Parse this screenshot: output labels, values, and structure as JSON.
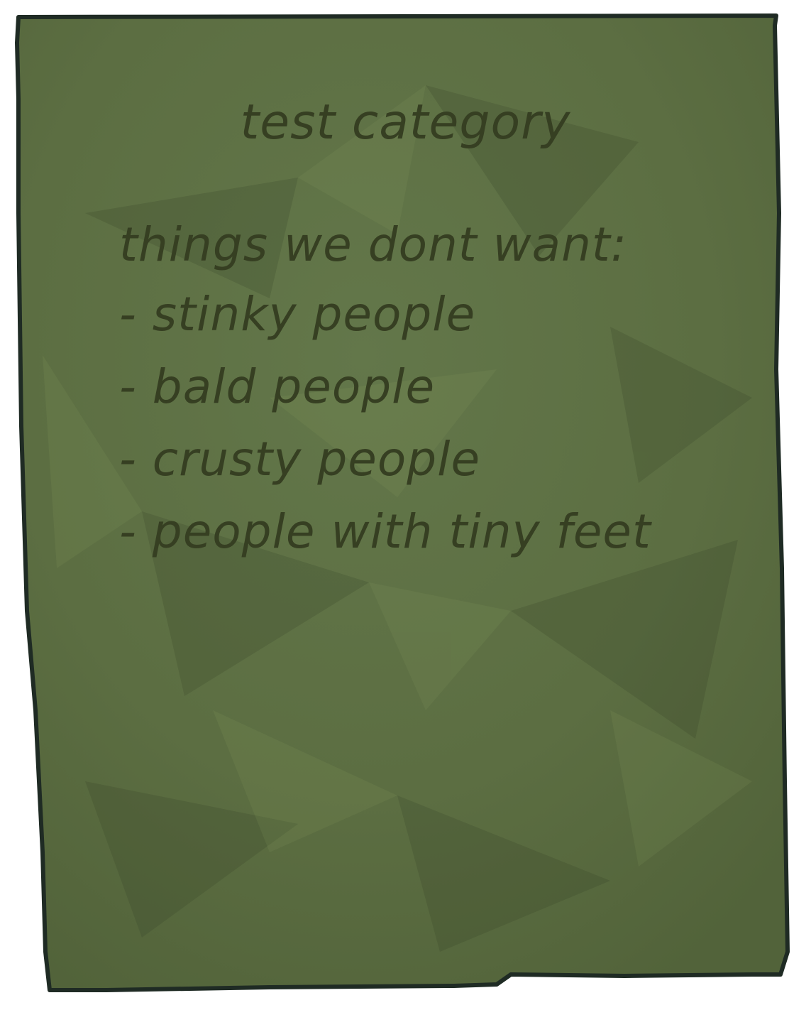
{
  "note": {
    "title": "test category",
    "heading": "things we dont want:",
    "items": [
      "- stinky people",
      "- bald people",
      "- crusty people",
      "- people with tiny feet"
    ]
  },
  "colors": {
    "paper": "#5e7044",
    "paper_dark": "#4e5e38",
    "paper_light": "#66794a",
    "border": "#1f2b24",
    "ink": "#363f22"
  }
}
